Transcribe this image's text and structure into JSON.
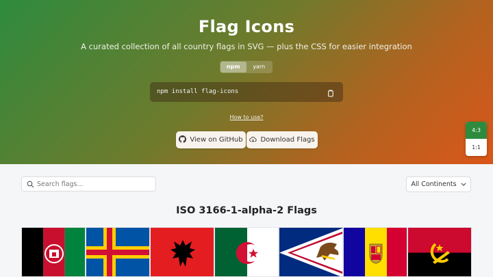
{
  "hero": {
    "title": "Flag Icons",
    "subtitle": "A curated collection of all country flags in SVG — plus the CSS for easier integration",
    "package_managers": [
      "npm",
      "yarn"
    ],
    "active_package_manager": "npm",
    "install_command": "npm install flag-icons",
    "how_to_use": "How to use?",
    "github_label": "View on GitHub",
    "download_label": "Download Flags"
  },
  "ratio_switch": {
    "options": [
      "4:3",
      "1:1"
    ],
    "active": "4:3"
  },
  "search": {
    "placeholder": "Search flags..."
  },
  "continent_filter": {
    "selected": "All Continents"
  },
  "section": {
    "title": "ISO 3166-1-alpha-2 Flags"
  },
  "flags": [
    {
      "name": "Afghanistan",
      "icon": "afghanistan-flag"
    },
    {
      "name": "Åland Islands",
      "icon": "aland-islands-flag"
    },
    {
      "name": "Albania",
      "icon": "albania-flag"
    },
    {
      "name": "Algeria",
      "icon": "algeria-flag"
    },
    {
      "name": "American Samoa",
      "icon": "american-samoa-flag"
    },
    {
      "name": "Andorra",
      "icon": "andorra-flag"
    },
    {
      "name": "Angola",
      "icon": "angola-flag"
    }
  ],
  "colors": {
    "accent": "#2e8b3e",
    "hero_gradient_start": "#2e8b3e",
    "hero_gradient_end": "#d9561a"
  }
}
